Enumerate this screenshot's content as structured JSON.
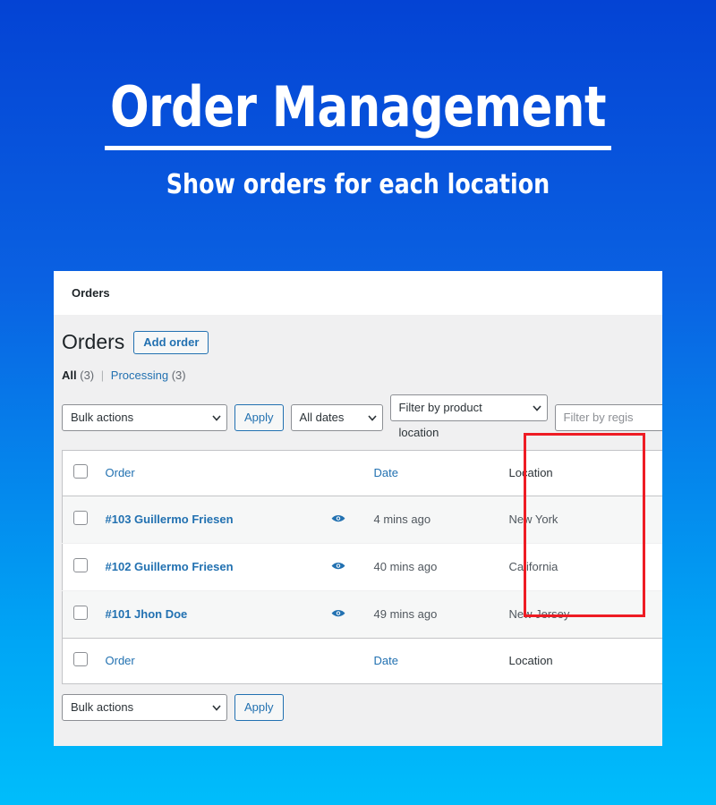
{
  "hero": {
    "title": "Order Management",
    "subtitle": "Show orders for each location"
  },
  "panel": {
    "topbar_title": "Orders",
    "page_title": "Orders",
    "add_order_label": "Add order"
  },
  "status_links": {
    "all_label": "All",
    "all_count": "(3)",
    "separator": "|",
    "processing_label": "Processing",
    "processing_count": "(3)"
  },
  "toolbar_top": {
    "bulk_actions_value": "Bulk actions",
    "apply_label": "Apply",
    "all_dates_value": "All dates",
    "product_location_value": "Filter by product location",
    "register_placeholder": "Filter by regis"
  },
  "toolbar_bottom": {
    "bulk_actions_value": "Bulk actions",
    "apply_label": "Apply"
  },
  "table": {
    "columns": {
      "order": "Order",
      "date": "Date",
      "location": "Location"
    },
    "rows": [
      {
        "order": "#103 Guillermo Friesen",
        "date": "4 mins ago",
        "location": "New York"
      },
      {
        "order": "#102 Guillermo Friesen",
        "date": "40 mins ago",
        "location": "California"
      },
      {
        "order": "#101 Jhon Doe",
        "date": "49 mins ago",
        "location": "New Jersey"
      }
    ]
  },
  "icons": {
    "preview": "eye-icon",
    "dropdown": "chevron-down-icon"
  },
  "colors": {
    "accent_blue": "#2271b1",
    "annotation_red": "#ee1c24",
    "bg_top": "#0443d4",
    "bg_bottom": "#00bdfb"
  }
}
